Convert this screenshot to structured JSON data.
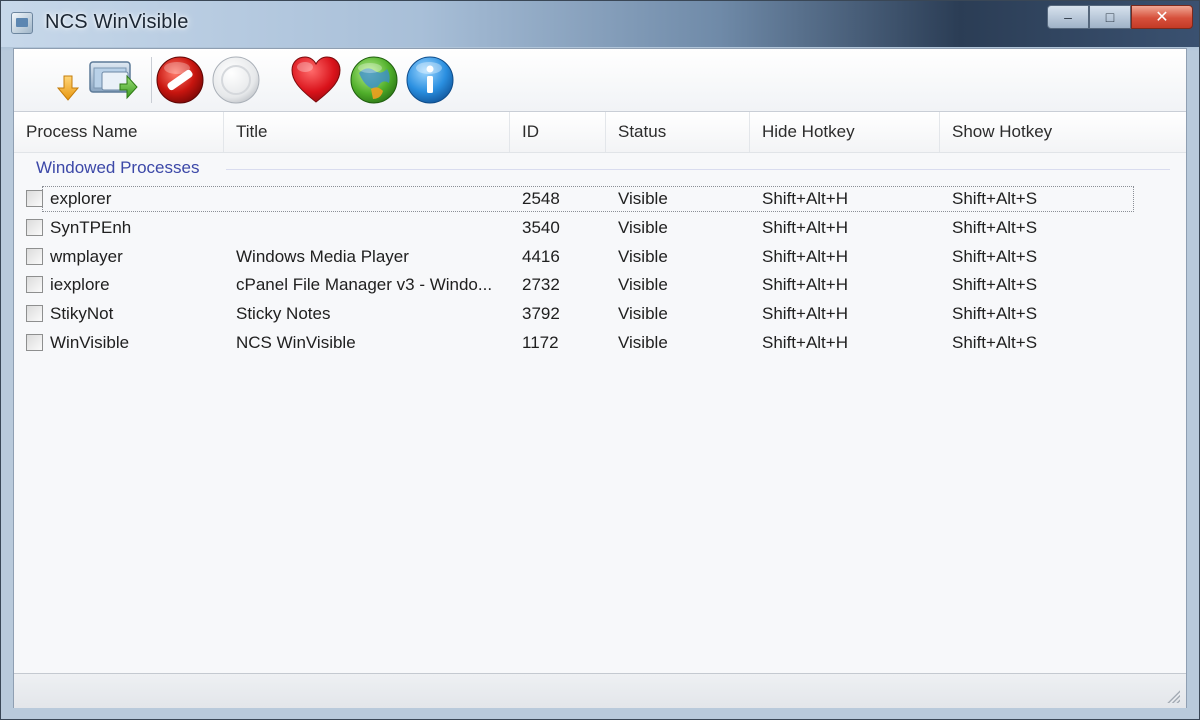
{
  "window": {
    "title": "NCS WinVisible"
  },
  "toolbar": {
    "buttons": [
      {
        "id": "refresh",
        "icon": "window-download-icon"
      },
      {
        "id": "hide",
        "icon": "no-entry-icon"
      },
      {
        "id": "show",
        "icon": "empty-circle-icon"
      },
      {
        "id": "favorite",
        "icon": "heart-icon"
      },
      {
        "id": "web",
        "icon": "globe-icon"
      },
      {
        "id": "about",
        "icon": "info-icon"
      }
    ]
  },
  "list": {
    "columns": [
      "Process Name",
      "Title",
      "ID",
      "Status",
      "Hide Hotkey",
      "Show Hotkey"
    ],
    "group": "Windowed Processes",
    "rows": [
      {
        "process": "explorer",
        "title": "",
        "id": "2548",
        "status": "Visible",
        "hide": "Shift+Alt+H",
        "show": "Shift+Alt+S"
      },
      {
        "process": "SynTPEnh",
        "title": "",
        "id": "3540",
        "status": "Visible",
        "hide": "Shift+Alt+H",
        "show": "Shift+Alt+S"
      },
      {
        "process": "wmplayer",
        "title": "Windows Media Player",
        "id": "4416",
        "status": "Visible",
        "hide": "Shift+Alt+H",
        "show": "Shift+Alt+S"
      },
      {
        "process": "iexplore",
        "title": "cPanel File Manager v3 - Windo...",
        "id": "2732",
        "status": "Visible",
        "hide": "Shift+Alt+H",
        "show": "Shift+Alt+S"
      },
      {
        "process": "StikyNot",
        "title": "Sticky Notes",
        "id": "3792",
        "status": "Visible",
        "hide": "Shift+Alt+H",
        "show": "Shift+Alt+S"
      },
      {
        "process": "WinVisible",
        "title": "NCS WinVisible",
        "id": "1172",
        "status": "Visible",
        "hide": "Shift+Alt+H",
        "show": "Shift+Alt+S"
      }
    ]
  },
  "colors": {
    "group_label": "#3c48a8",
    "close_button": "#d6503b"
  }
}
